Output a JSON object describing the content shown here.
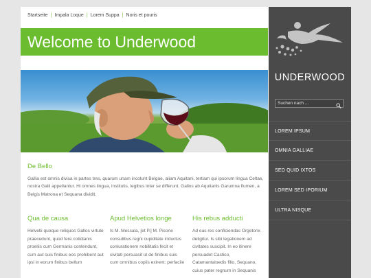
{
  "nav": {
    "items": [
      "Startseite",
      "Impala Loque",
      "Lorem Suppa",
      "Noris et pouris"
    ]
  },
  "header": {
    "title": "Welcome to Underwood"
  },
  "intro": {
    "heading": "De Bello",
    "text": "Gallia est omnis divisa in partes tres, quarum unam incolunt Belgae, aliam Aquitani, tertiam qui ipsorum lingua Celtae, nostra Galli appellantur. Hi omnes lingua, institutis, legibus inter se differunt. Gallos ab Aquitanis Garumna flumen, a Belgis Matrona et Sequana dividit."
  },
  "columns": [
    {
      "heading": "Qua de causa",
      "text": "Helvetii quoque reliquos Gallos virtute praecedunt, quod fere cotidianis proeliis cum Germanis contendunt, cum aut suis finibus eos prohibent aut ipsi in eorum finibus bellum"
    },
    {
      "heading": "Apud Helvetios longe",
      "text": "Is M. Messala, [et P.] M. Pisone consulibus regni cupiditate inductus coniurationem nobilitatis fecit et civitati persuasit ut de finibus suis cum omnibus copiis exirent: perfacile"
    },
    {
      "heading": "His rebus adducti",
      "text": "Ad eas res conficiendas Orgetorix deligitur. Is sibi legationem ad civitates suscipit. In eo itinere persuadet Castico, Catamantaloedis filio, Sequano, cuius pater regnum in Sequanis"
    }
  ],
  "sidebar": {
    "brand": "UNDERWOOD",
    "search_placeholder": "Suchen nach ...",
    "menu": [
      "LOREM IPSUM",
      "OMNIA GALLIAE",
      "SED QUID IXTOS",
      "LOREM SED IPORIUM",
      "ULTRA NISQUE"
    ]
  },
  "colors": {
    "accent": "#6bbd2f",
    "sidebar": "#4a4a4a",
    "page_bg": "#e6e6e6"
  },
  "icons": {
    "logo": "flying-figure-logo",
    "search": "search-icon"
  }
}
